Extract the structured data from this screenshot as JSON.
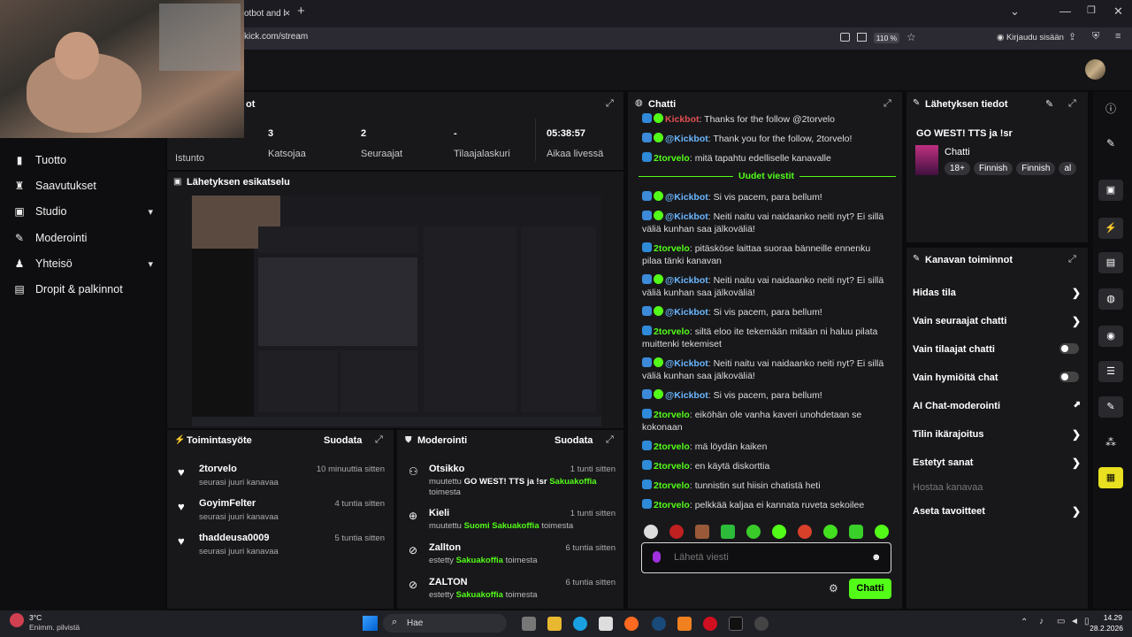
{
  "browser": {
    "tab_title": "otbot and l",
    "url": "kick.com/stream",
    "zoom": "110 %",
    "login": "Kirjaudu sisään"
  },
  "sidebar": {
    "items": [
      {
        "label": "Tuotto",
        "icon": "money-icon"
      },
      {
        "label": "Saavutukset",
        "icon": "trophy-icon"
      },
      {
        "label": "Studio",
        "icon": "camera-icon",
        "chevron": true
      },
      {
        "label": "Moderointi",
        "icon": "wrench-icon"
      },
      {
        "label": "Yhteisö",
        "icon": "people-icon",
        "chevron": true
      },
      {
        "label": "Dropit & palkinnot",
        "icon": "gift-icon"
      }
    ]
  },
  "stats": {
    "header_partial": "ot",
    "session_label": "Istunto",
    "items": [
      {
        "value": "3",
        "label": "Katsojaa"
      },
      {
        "value": "2",
        "label": "Seuraajat"
      },
      {
        "value": "-",
        "label": "Tilaajalaskuri"
      },
      {
        "value": "05:38:57",
        "label": "Aikaa livessä"
      }
    ]
  },
  "preview": {
    "title": "Lähetyksen esikatselu"
  },
  "activity": {
    "title": "Toimintasyöte",
    "filter": "Suodata",
    "rows": [
      {
        "name": "2torvelo",
        "sub": "seurasi juuri kanavaa",
        "time": "10 minuuttia sitten"
      },
      {
        "name": "GoyimFelter",
        "sub": "seurasi juuri kanavaa",
        "time": "4 tuntia sitten"
      },
      {
        "name": "thaddeusa0009",
        "sub": "seurasi juuri kanavaa",
        "time": "5 tuntia sitten"
      }
    ]
  },
  "moderation": {
    "title": "Moderointi",
    "filter": "Suodata",
    "rows": [
      {
        "title": "Otsikko",
        "time": "1 tunti sitten",
        "pre": "muutettu ",
        "bold": "GO WEST! TTS ja !sr",
        "user": "Sakuakoffia",
        "post": "toimesta"
      },
      {
        "title": "Kieli",
        "time": "1 tunti sitten",
        "pre": "muutettu ",
        "bold": "Suomi",
        "user": "Sakuakoffia",
        "post": "toimesta"
      },
      {
        "title": "Zallton",
        "time": "6 tuntia sitten",
        "pre": "estetty ",
        "bold": "",
        "user": "Sakuakoffia",
        "post": "toimesta"
      },
      {
        "title": "ZALTON",
        "time": "6 tuntia sitten",
        "pre": "estetty ",
        "bold": "",
        "user": "Sakuakoffia",
        "post": "toimesta"
      }
    ]
  },
  "chat": {
    "title": "Chatti",
    "new_messages": "Uudet viestit",
    "top_partial": {
      "user": "Kickbot",
      "text": "Thanks for the follow @2torvelo"
    },
    "before_divider": [
      {
        "user": "@Kickbot",
        "bot": true,
        "text": "Thank you for the follow, 2torvelo!"
      },
      {
        "user": "2torvelo",
        "bot": false,
        "text": "mitä tapahtu edelliselle kanavalle"
      }
    ],
    "messages": [
      {
        "user": "@Kickbot",
        "bot": true,
        "text": "Si vis pacem, para bellum!"
      },
      {
        "user": "@Kickbot",
        "bot": true,
        "text": "Neiti naitu vai naidaanko neiti nyt? Ei sillä väliä kunhan saa jälkoväliä!"
      },
      {
        "user": "2torvelo",
        "bot": false,
        "text": "pitäsköse laittaa suoraa bänneille ennenku pilaa tänki kanavan"
      },
      {
        "user": "@Kickbot",
        "bot": true,
        "text": "Neiti naitu vai naidaanko neiti nyt? Ei sillä väliä kunhan saa jälkoväliä!"
      },
      {
        "user": "@Kickbot",
        "bot": true,
        "text": "Si vis pacem, para bellum!"
      },
      {
        "user": "2torvelo",
        "bot": false,
        "text": "siltä eloo ite tekemään mitään ni haluu pilata muittenki tekemiset"
      },
      {
        "user": "@Kickbot",
        "bot": true,
        "text": "Neiti naitu vai naidaanko neiti nyt? Ei sillä väliä kunhan saa jälkoväliä!"
      },
      {
        "user": "@Kickbot",
        "bot": true,
        "text": "Si vis pacem, para bellum!"
      },
      {
        "user": "2torvelo",
        "bot": false,
        "text": "eiköhän ole vanha kaveri unohdetaan se kokonaan"
      },
      {
        "user": "2torvelo",
        "bot": false,
        "text": "mä löydän kaiken"
      },
      {
        "user": "2torvelo",
        "bot": false,
        "text": "en käytä diskorttia"
      },
      {
        "user": "2torvelo",
        "bot": false,
        "text": "tunnistin sut hiisin chatistä heti"
      },
      {
        "user": "2torvelo",
        "bot": false,
        "text": "pelkkää kaljaa ei kannata ruveta sekoilee"
      }
    ],
    "input_placeholder": "Lähetä viesti",
    "send_label": "Chatti"
  },
  "stream_info": {
    "title": "Lähetyksen tiedot",
    "stream_title": "GO WEST! TTS ja !sr",
    "category": "Chatti",
    "tags": [
      "18+",
      "Finnish",
      "Finnish",
      "al"
    ]
  },
  "channel_actions": {
    "title": "Kanavan toiminnot",
    "rows": [
      {
        "label": "Hidas tila",
        "control": "arrow"
      },
      {
        "label": "Vain seuraajat chatti",
        "control": "arrow"
      },
      {
        "label": "Vain tilaajat chatti",
        "control": "toggle"
      },
      {
        "label": "Vain hymiöitä chat",
        "control": "toggle"
      },
      {
        "label": "AI Chat-moderointi",
        "control": "external"
      },
      {
        "label": "Tilin ikärajoitus",
        "control": "arrow"
      },
      {
        "label": "Estetyt sanat",
        "control": "arrow"
      },
      {
        "label": "Hostaa kanavaa",
        "control": "none",
        "disabled": true
      },
      {
        "label": "Aseta tavoitteet",
        "control": "arrow"
      }
    ]
  },
  "taskbar": {
    "temp": "3°C",
    "weather": "Enimm. pilvistä",
    "search": "Hae",
    "time": "14.29",
    "date": "28.2.2026"
  },
  "colors": {
    "accent": "#53fc18",
    "bot": "#6bb7ff",
    "panel": "#18181b"
  }
}
